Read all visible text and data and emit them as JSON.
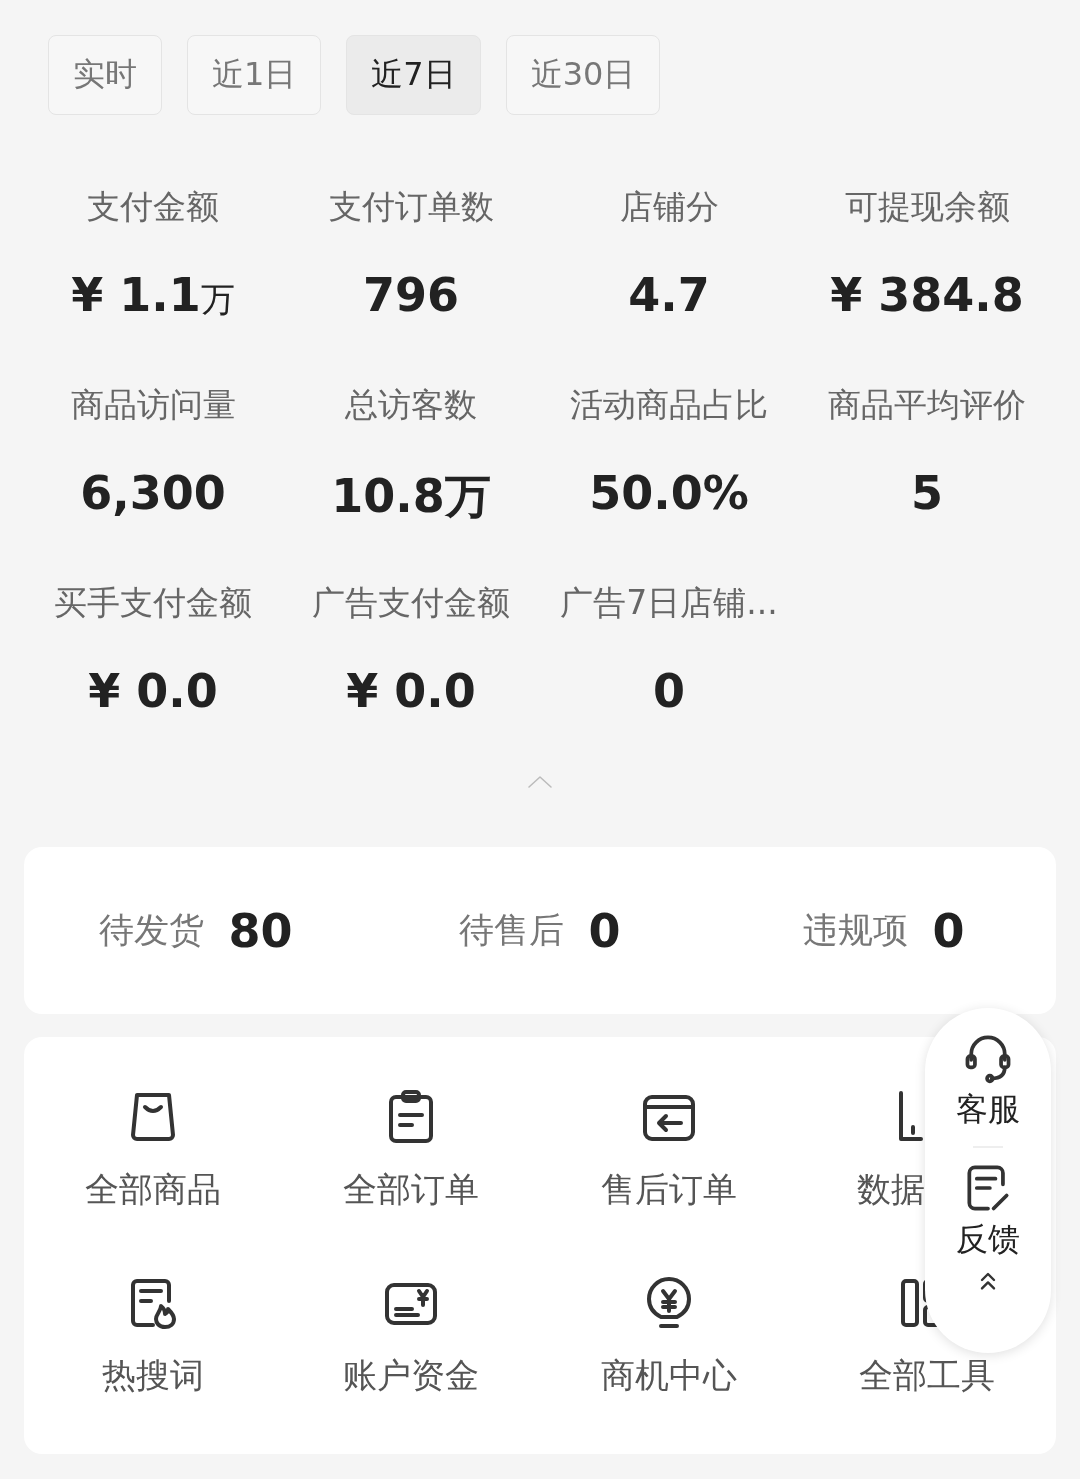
{
  "period_tabs": [
    {
      "label": "实时",
      "selected": false
    },
    {
      "label": "近1日",
      "selected": false
    },
    {
      "label": "近7日",
      "selected": true
    },
    {
      "label": "近30日",
      "selected": false
    }
  ],
  "stats": [
    {
      "label": "支付金额",
      "value": "¥ 1.1",
      "unit": "万"
    },
    {
      "label": "支付订单数",
      "value": "796"
    },
    {
      "label": "店铺分",
      "value": "4.7"
    },
    {
      "label": "可提现余额",
      "value": "¥ 384.8"
    },
    {
      "label": "商品访问量",
      "value": "6,300"
    },
    {
      "label": "总访客数",
      "value": "10.8万"
    },
    {
      "label": "活动商品占比",
      "value": "50.0%"
    },
    {
      "label": "商品平均评价",
      "value": "5"
    },
    {
      "label": "买手支付金额",
      "value": "¥ 0.0"
    },
    {
      "label": "广告支付金额",
      "value": "¥ 0.0"
    },
    {
      "label": "广告7日店铺...",
      "value": "0"
    }
  ],
  "todo": [
    {
      "label": "待发货",
      "count": "80"
    },
    {
      "label": "待售后",
      "count": "0"
    },
    {
      "label": "违规项",
      "count": "0"
    }
  ],
  "tools": [
    {
      "kind": "bag",
      "label": "全部商品"
    },
    {
      "kind": "clipboard",
      "label": "全部订单"
    },
    {
      "kind": "return",
      "label": "售后订单"
    },
    {
      "kind": "chart",
      "label": "数据",
      "partly_hidden": true
    },
    {
      "kind": "hot",
      "label": "热搜词"
    },
    {
      "kind": "card",
      "label": "账户资金"
    },
    {
      "kind": "bulb",
      "label": "商机中心"
    },
    {
      "kind": "tools",
      "label": "全部工具"
    }
  ],
  "float_panel": [
    {
      "kind": "service",
      "label": "客服"
    },
    {
      "kind": "feedback",
      "label": "反馈"
    },
    {
      "kind": "top"
    }
  ]
}
